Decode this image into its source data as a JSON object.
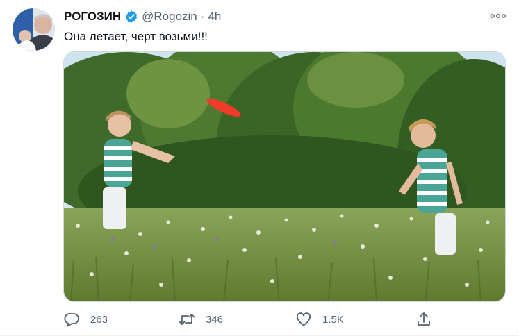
{
  "tweet": {
    "display_name": "РОГОЗИН",
    "handle": "@Rogozin",
    "separator": "·",
    "time": "4h",
    "text": "Она летает, черт возьми!!!",
    "verified": true,
    "accent_color": "#1d9bf0"
  },
  "actions": {
    "reply": {
      "icon": "reply-icon",
      "count": "263"
    },
    "retweet": {
      "icon": "retweet-icon",
      "count": "346"
    },
    "like": {
      "icon": "heart-icon",
      "count": "1.5K"
    },
    "share": {
      "icon": "share-icon"
    }
  },
  "more_icon": "more-horizontal-icon"
}
